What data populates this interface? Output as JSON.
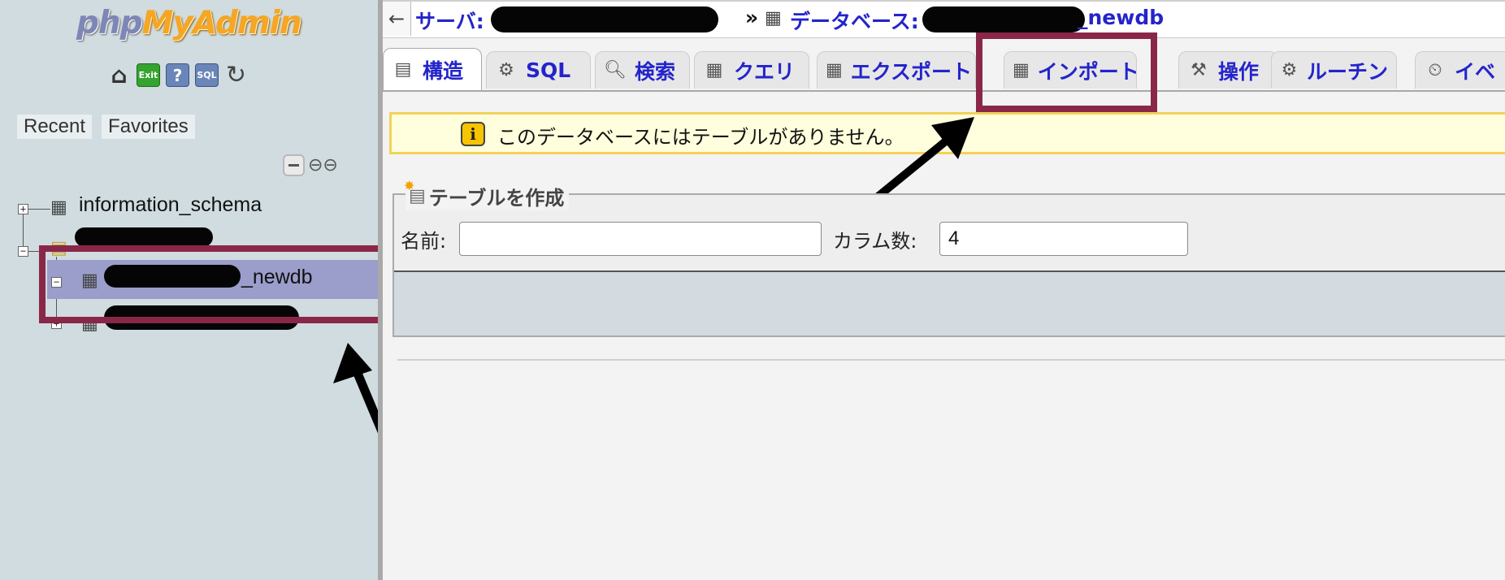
{
  "nav": {
    "logo_php": "php",
    "logo_myadmin": "MyAdmin",
    "icons": [
      "home-icon",
      "exit-icon",
      "docs-icon",
      "sql-query-icon",
      "reload-icon"
    ],
    "exit_text": "Exit",
    "sql_text": "SQL",
    "recent_label": "Recent",
    "favorites_label": "Favorites",
    "tree": {
      "db1": "information_schema",
      "selected_db_suffix": "_newdb"
    }
  },
  "topbar": {
    "back": "←",
    "server_label": "サーバ:",
    "separator": "»",
    "database_label": "データベース:",
    "database_suffix": "_newdb"
  },
  "tabs": [
    {
      "label": "構造",
      "icon": "structure-icon"
    },
    {
      "label": "SQL",
      "icon": "sql-icon"
    },
    {
      "label": "検索",
      "icon": "search-icon"
    },
    {
      "label": "クエリ",
      "icon": "query-icon"
    },
    {
      "label": "エクスポート",
      "icon": "export-icon"
    },
    {
      "label": "インポート",
      "icon": "import-icon"
    },
    {
      "label": "操作",
      "icon": "operations-icon"
    },
    {
      "label": "ルーチン",
      "icon": "routines-icon"
    },
    {
      "label": "イベ",
      "icon": "events-icon"
    }
  ],
  "notice": {
    "text": "このデータベースにはテーブルがありません。"
  },
  "create_table": {
    "legend": "テーブルを作成",
    "name_label": "名前:",
    "name_value": "",
    "columns_label": "カラム数:",
    "columns_value": "4"
  },
  "colors": {
    "highlight": "#8a2748",
    "link": "#2424cc",
    "selected_row": "#9b9dcb",
    "nav_bg": "#d0dce0"
  }
}
